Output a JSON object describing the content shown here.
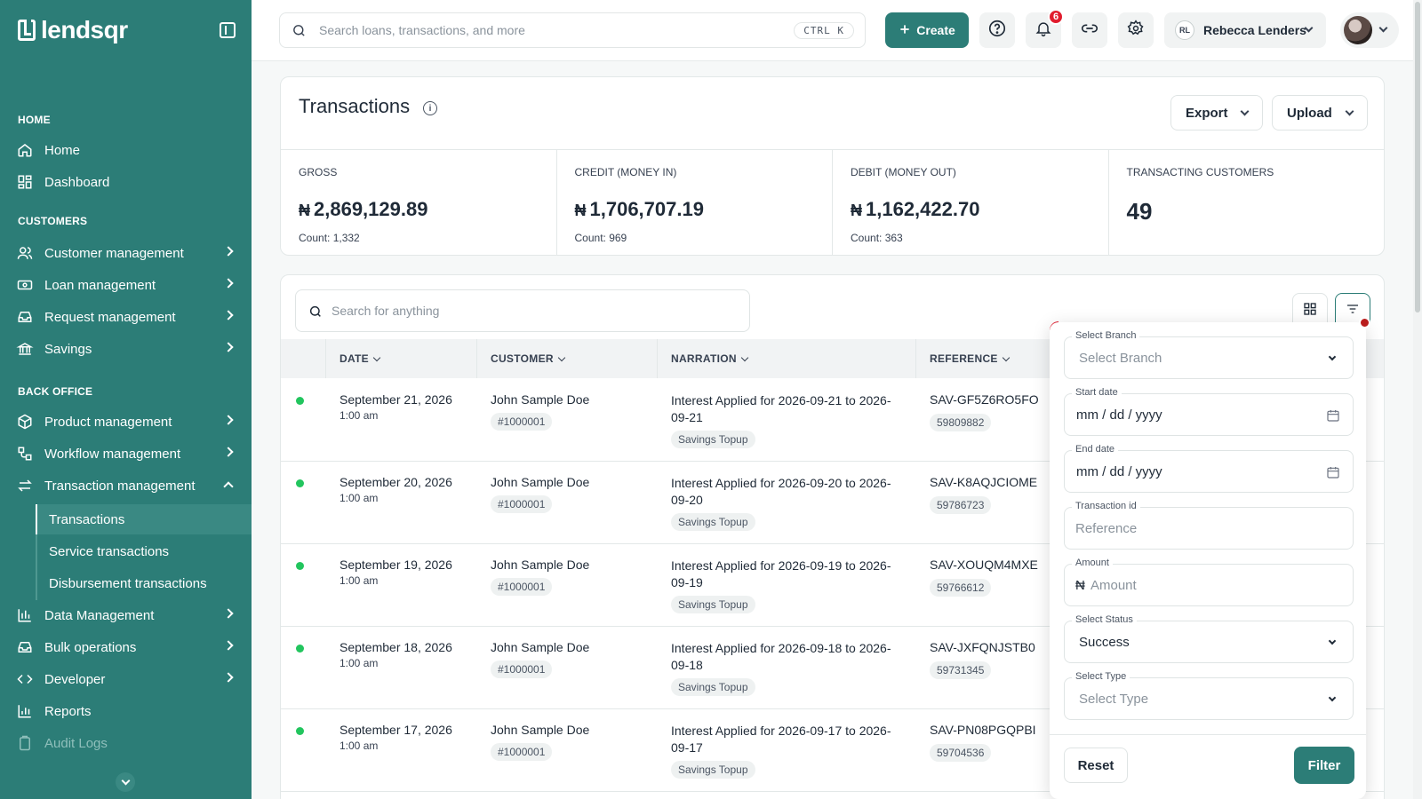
{
  "brand": {
    "name": "lendsqr"
  },
  "sidebar": {
    "sections": {
      "home": "HOME",
      "customers": "CUSTOMERS",
      "back_office": "BACK OFFICE"
    },
    "items": {
      "home": "Home",
      "dashboard": "Dashboard",
      "customer_management": "Customer management",
      "loan_management": "Loan management",
      "request_management": "Request management",
      "savings": "Savings",
      "product_management": "Product management",
      "workflow_management": "Workflow management",
      "transaction_management": "Transaction management",
      "data_management": "Data Management",
      "bulk_operations": "Bulk operations",
      "developer": "Developer",
      "reports": "Reports",
      "audit_logs": "Audit Logs"
    },
    "sub_items": {
      "transactions": "Transactions",
      "service_transactions": "Service transactions",
      "disbursement_transactions": "Disbursement transactions"
    }
  },
  "topbar": {
    "search_placeholder": "Search loans, transactions, and more",
    "shortcut": "CTRL K",
    "create_label": "Create",
    "notification_count": "6",
    "user_initials": "RL",
    "user_name": "Rebecca Lenders"
  },
  "page": {
    "title": "Transactions",
    "export_label": "Export",
    "upload_label": "Upload"
  },
  "stats": {
    "currency": "₦",
    "gross": {
      "label": "GROSS",
      "value": "2,869,129.89",
      "count": "Count: 1,332"
    },
    "credit": {
      "label": "CREDIT (MONEY IN)",
      "value": "1,706,707.19",
      "count": "Count: 969"
    },
    "debit": {
      "label": "DEBIT (MONEY OUT)",
      "value": "1,162,422.70",
      "count": "Count: 363"
    },
    "customers": {
      "label": "TRANSACTING CUSTOMERS",
      "value": "49"
    }
  },
  "table": {
    "search_placeholder": "Search for anything",
    "columns": {
      "date": "DATE",
      "customer": "CUSTOMER",
      "narration": "NARRATION",
      "reference": "REFERENCE"
    },
    "rows": [
      {
        "date": "September 21, 2026",
        "time": "1:00 am",
        "customer": "John Sample Doe",
        "customer_id": "#1000001",
        "narration": "Interest Applied for 2026-09-21 to 2026-09-21",
        "type": "Savings Topup",
        "reference": "SAV-GF5Z6RO5FO",
        "ref_id": "59809882"
      },
      {
        "date": "September 20, 2026",
        "time": "1:00 am",
        "customer": "John Sample Doe",
        "customer_id": "#1000001",
        "narration": "Interest Applied for 2026-09-20 to 2026-09-20",
        "type": "Savings Topup",
        "reference": "SAV-K8AQJCIOME",
        "ref_id": "59786723"
      },
      {
        "date": "September 19, 2026",
        "time": "1:00 am",
        "customer": "John Sample Doe",
        "customer_id": "#1000001",
        "narration": "Interest Applied for 2026-09-19 to 2026-09-19",
        "type": "Savings Topup",
        "reference": "SAV-XOUQM4MXE",
        "ref_id": "59766612"
      },
      {
        "date": "September 18, 2026",
        "time": "1:00 am",
        "customer": "John Sample Doe",
        "customer_id": "#1000001",
        "narration": "Interest Applied for 2026-09-18 to 2026-09-18",
        "type": "Savings Topup",
        "reference": "SAV-JXFQNJSTB0",
        "ref_id": "59731345"
      },
      {
        "date": "September 17, 2026",
        "time": "1:00 am",
        "customer": "John Sample Doe",
        "customer_id": "#1000001",
        "narration": "Interest Applied for 2026-09-17 to 2026-09-17",
        "type": "Savings Topup",
        "reference": "SAV-PN08PGQPBI",
        "ref_id": "59704536"
      }
    ]
  },
  "filter": {
    "branch_label": "Select Branch",
    "branch_value": "Select Branch",
    "start_label": "Start date",
    "start_value": "mm / dd / yyyy",
    "end_label": "End date",
    "end_value": "mm / dd / yyyy",
    "txid_label": "Transaction id",
    "txid_placeholder": "Reference",
    "amount_label": "Amount",
    "amount_placeholder": "Amount",
    "amount_currency": "₦",
    "status_label": "Select Status",
    "status_value": "Success",
    "type_label": "Select Type",
    "type_value": "Select Type",
    "reset_label": "Reset",
    "filter_label": "Filter"
  },
  "colors": {
    "brand": "#2c7d77",
    "status_success": "#22c55e",
    "badge": "#e11d2e"
  }
}
